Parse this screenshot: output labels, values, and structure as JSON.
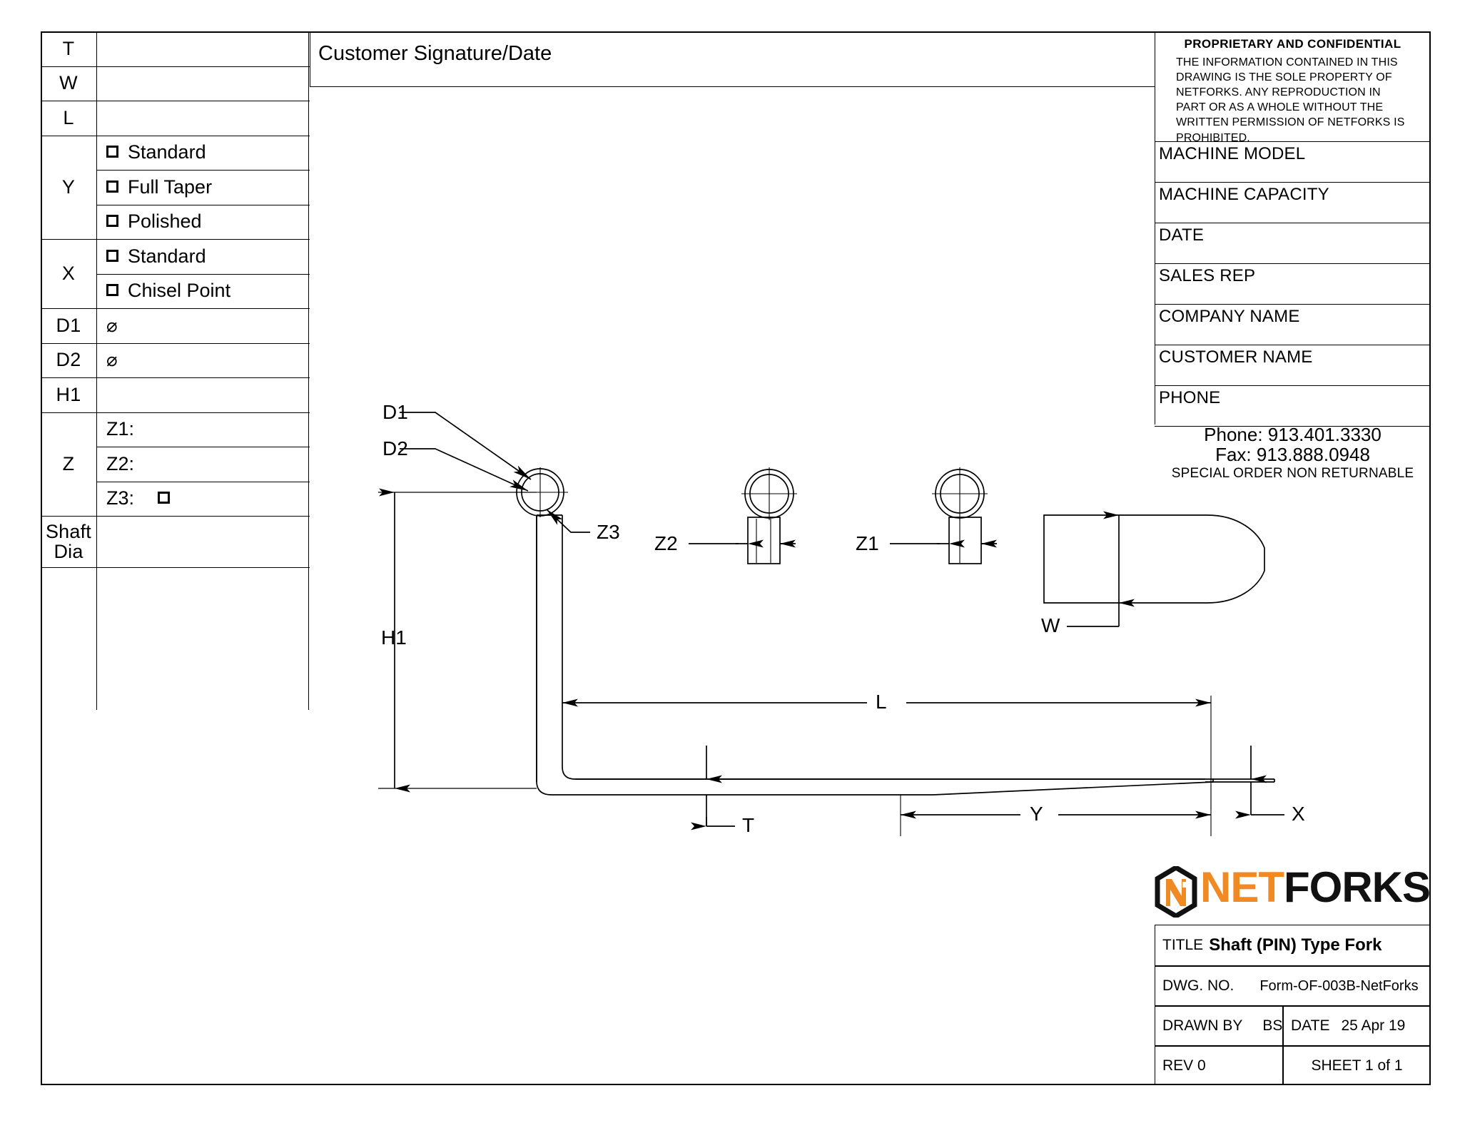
{
  "sheet": {
    "customer_signature_label": "Customer Signature/Date"
  },
  "spec_table": {
    "rows": [
      {
        "label": "T",
        "value": ""
      },
      {
        "label": "W",
        "value": ""
      },
      {
        "label": "L",
        "value": ""
      },
      {
        "label": "Y",
        "options": [
          "Standard",
          "Full Taper",
          "Polished"
        ]
      },
      {
        "label": "X",
        "options": [
          "Standard",
          "Chisel Point"
        ]
      },
      {
        "label": "D1",
        "value": "⌀"
      },
      {
        "label": "D2",
        "value": "⌀"
      },
      {
        "label": "H1",
        "value": ""
      },
      {
        "label": "Z",
        "sub": [
          "Z1:",
          "Z2:",
          "Z3:"
        ]
      },
      {
        "label": "Shaft Dia",
        "label_line1": "Shaft",
        "label_line2": "Dia",
        "value": ""
      }
    ]
  },
  "proprietary": {
    "title": "PROPRIETARY AND CONFIDENTIAL",
    "body": "THE INFORMATION CONTAINED IN THIS DRAWING IS THE SOLE PROPERTY OF NETFORKS.  ANY REPRODUCTION IN PART OR AS A WHOLE WITHOUT THE WRITTEN PERMISSION OF NETFORKS IS PROHIBITED."
  },
  "info_fields": [
    {
      "label": "MACHINE MODEL",
      "value": ""
    },
    {
      "label": "MACHINE CAPACITY",
      "value": ""
    },
    {
      "label": "DATE",
      "value": ""
    },
    {
      "label": "SALES REP",
      "value": ""
    },
    {
      "label": "COMPANY NAME",
      "value": ""
    },
    {
      "label": "CUSTOMER NAME",
      "value": ""
    },
    {
      "label": "PHONE",
      "value": ""
    }
  ],
  "contact": {
    "phone": "Phone: 913.401.3330",
    "fax": "Fax: 913.888.0948",
    "note": "SPECIAL ORDER NON RETURNABLE"
  },
  "logo": {
    "mark": "NF",
    "word_part1": "NET",
    "word_part2": "FORKS",
    "color_orange": "#F08A24",
    "color_black": "#111111"
  },
  "title_block": {
    "title_label": "TITLE",
    "title_value": "Shaft (PIN) Type Fork",
    "dwg_label": "DWG. NO.",
    "dwg_value": "Form-OF-003B-NetForks",
    "drawn_by_label": "DRAWN BY",
    "drawn_by_value": "BS",
    "date_label": "DATE",
    "date_value": "25 Apr 19",
    "rev_value": "REV 0",
    "sheet_value": "SHEET 1 of 1"
  },
  "drawing_labels": {
    "d1": "D1",
    "d2": "D2",
    "z3": "Z3",
    "z2": "Z2",
    "z1": "Z1",
    "w": "W",
    "h1": "H1",
    "l": "L",
    "t": "T",
    "y": "Y",
    "x": "X"
  }
}
